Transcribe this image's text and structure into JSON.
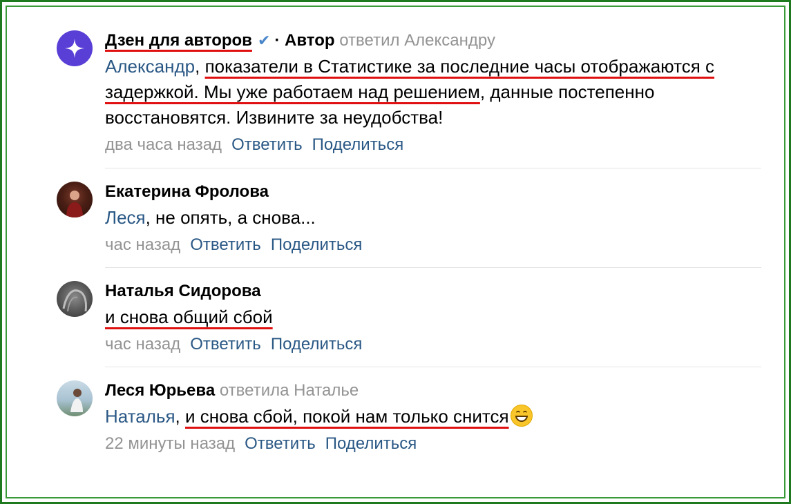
{
  "comments": [
    {
      "author": "Дзен для авторов",
      "role": "· Автор",
      "reply_to": "ответил Александру",
      "mention": "Александр",
      "text_sep": ",",
      "text_underlined": "показатели в Статистике за последние часы отображаются с задержкой. Мы уже работаем над решением",
      "text_rest": ", данные постепенно восстановятся. Извините за неудобства!",
      "time": "два часа назад",
      "reply_label": "Ответить",
      "share_label": "Поделиться",
      "verified_icon": "checkmark-icon",
      "avatar_icon": "sparkle-icon"
    },
    {
      "author": "Екатерина Фролова",
      "mention": "Леся",
      "text": ", не опять, а снова...",
      "time": "час назад",
      "reply_label": "Ответить",
      "share_label": "Поделиться"
    },
    {
      "author": "Наталья Сидорова",
      "text_underlined": "и снова общий сбой",
      "time": "час назад",
      "reply_label": "Ответить",
      "share_label": "Поделиться"
    },
    {
      "author": "Леся Юрьева",
      "reply_to": "ответила Наталье",
      "mention": "Наталья",
      "text_sep": ",",
      "text_underlined": "и снова сбой, покой нам только снится",
      "emoji": "grinning-face-emoji",
      "time": "22 минуты назад",
      "reply_label": "Ответить",
      "share_label": "Поделиться"
    }
  ],
  "colors": {
    "frame": "#1f7a1f",
    "link": "#2a5885",
    "meta": "#939393",
    "highlight": "#e01010",
    "verified": "#4a86c8",
    "dzen_avatar": "#5a3fd6"
  }
}
